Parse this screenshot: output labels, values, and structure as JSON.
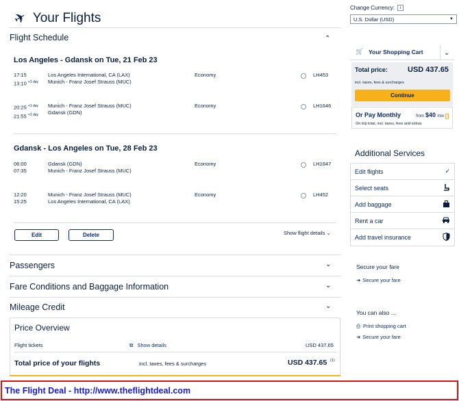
{
  "header": {
    "title": "Your Flights",
    "plane_icon": "airplane-icon"
  },
  "schedule": {
    "title": "Flight Schedule",
    "outbound": {
      "title": "Los Angeles - Gdansk on Tue, 21 Feb 23",
      "segments": [
        {
          "dep_time": "17:15",
          "arr_time": "13:10",
          "arr_plus": "+1 day",
          "dep_airport": "Los Angeles International, CA (LAX)",
          "arr_airport": "Munich - Franz Josef Strauss (MUC)",
          "cabin": "Economy",
          "flight": "LH453"
        },
        {
          "dep_time": "20:25",
          "dep_plus": "+1 day",
          "arr_time": "21:55",
          "arr_plus": "+1 day",
          "dep_airport": "Munich - Franz Josef Strauss (MUC)",
          "arr_airport": "Gdansk (GDN)",
          "cabin": "Economy",
          "flight": "LH1646"
        }
      ]
    },
    "inbound": {
      "title": "Gdansk - Los Angeles on Tue, 28 Feb 23",
      "segments": [
        {
          "dep_time": "06:00",
          "arr_time": "07:35",
          "dep_airport": "Gdansk (GDN)",
          "arr_airport": "Munich - Franz Josef Strauss (MUC)",
          "cabin": "Economy",
          "flight": "LH1647"
        },
        {
          "dep_time": "12:20",
          "arr_time": "15:25",
          "dep_airport": "Munich - Franz Josef Strauss (MUC)",
          "arr_airport": "Los Angeles International, CA (LAX)",
          "cabin": "Economy",
          "flight": "LH452"
        }
      ]
    },
    "edit_label": "Edit",
    "delete_label": "Delete",
    "show_details_label": "Show flight details"
  },
  "sections": {
    "passengers": "Passengers",
    "fare_conditions": "Fare Conditions and Baggage Information",
    "mileage": "Mileage Credit"
  },
  "price_overview": {
    "title": "Price Overview",
    "tickets_label": "Flight tickets",
    "show_details": "Show details",
    "tickets_value": "USD 437.65",
    "total_label": "Total price of your flights",
    "total_note": "incl. taxes, fees & surcharges",
    "total_value": "USD 437.65",
    "footnote": "(1)"
  },
  "currency": {
    "label": "Change Currency:",
    "info": "i",
    "selected": "U.S. Dollar (USD)"
  },
  "cart": {
    "title": "Your Shopping Cart",
    "total_label": "Total price:",
    "total_value": "USD 437.65",
    "total_note": "incl. taxes, fees & surcharges",
    "continue_label": "Continue",
    "monthly_title": "Or Pay Monthly",
    "monthly_from": "from",
    "monthly_amount": "$40",
    "monthly_unit": "/mo",
    "monthly_note": "On trip total, incl. taxes, fees and extras"
  },
  "additional": {
    "title": "Additional Services",
    "items": [
      {
        "label": "Edit flights",
        "icon": "check-icon"
      },
      {
        "label": "Select seats",
        "icon": "seat-icon"
      },
      {
        "label": "Add baggage",
        "icon": "baggage-icon"
      },
      {
        "label": "Rent a car",
        "icon": "car-icon"
      },
      {
        "label": "Add travel insurance",
        "icon": "shield-icon"
      }
    ]
  },
  "secure": {
    "title": "Secure your fare",
    "link": "Secure your fare"
  },
  "also": {
    "title": "You can also ...",
    "print": "Print shopping cart",
    "secure": "Secure your fare"
  },
  "banner": {
    "text": "The Flight Deal - http://www.theflightdeal.com"
  },
  "colors": {
    "navy": "#0a1d3d",
    "accent": "#f7b21b",
    "banner_border": "#e01010",
    "banner_text": "#1a1acc"
  }
}
